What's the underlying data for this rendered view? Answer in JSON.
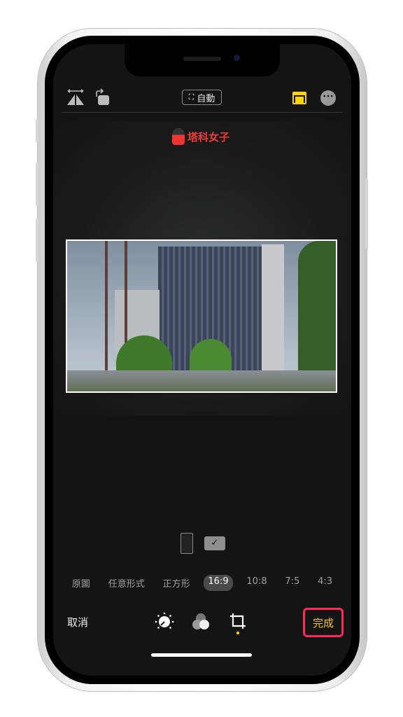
{
  "toolbar": {
    "aspect_label": "自動",
    "icons": [
      "flip-horizontal-icon",
      "rotate-icon",
      "aspect-ratio-icon",
      "more-icon"
    ],
    "accent": "#ffd60a"
  },
  "watermark": {
    "text": "塔科女子"
  },
  "orientation": {
    "icons": [
      "portrait-icon",
      "landscape-icon"
    ],
    "selected": "landscape"
  },
  "ratios": {
    "items": [
      "原圖",
      "任意形式",
      "正方形",
      "16:9",
      "10:8",
      "7:5",
      "4:3"
    ],
    "selected": "16:9"
  },
  "bottom": {
    "cancel": "取消",
    "done": "完成",
    "tools": [
      "adjust-icon",
      "filters-icon",
      "crop-icon"
    ],
    "active_tool": "crop",
    "highlight": "#ff2d55"
  }
}
